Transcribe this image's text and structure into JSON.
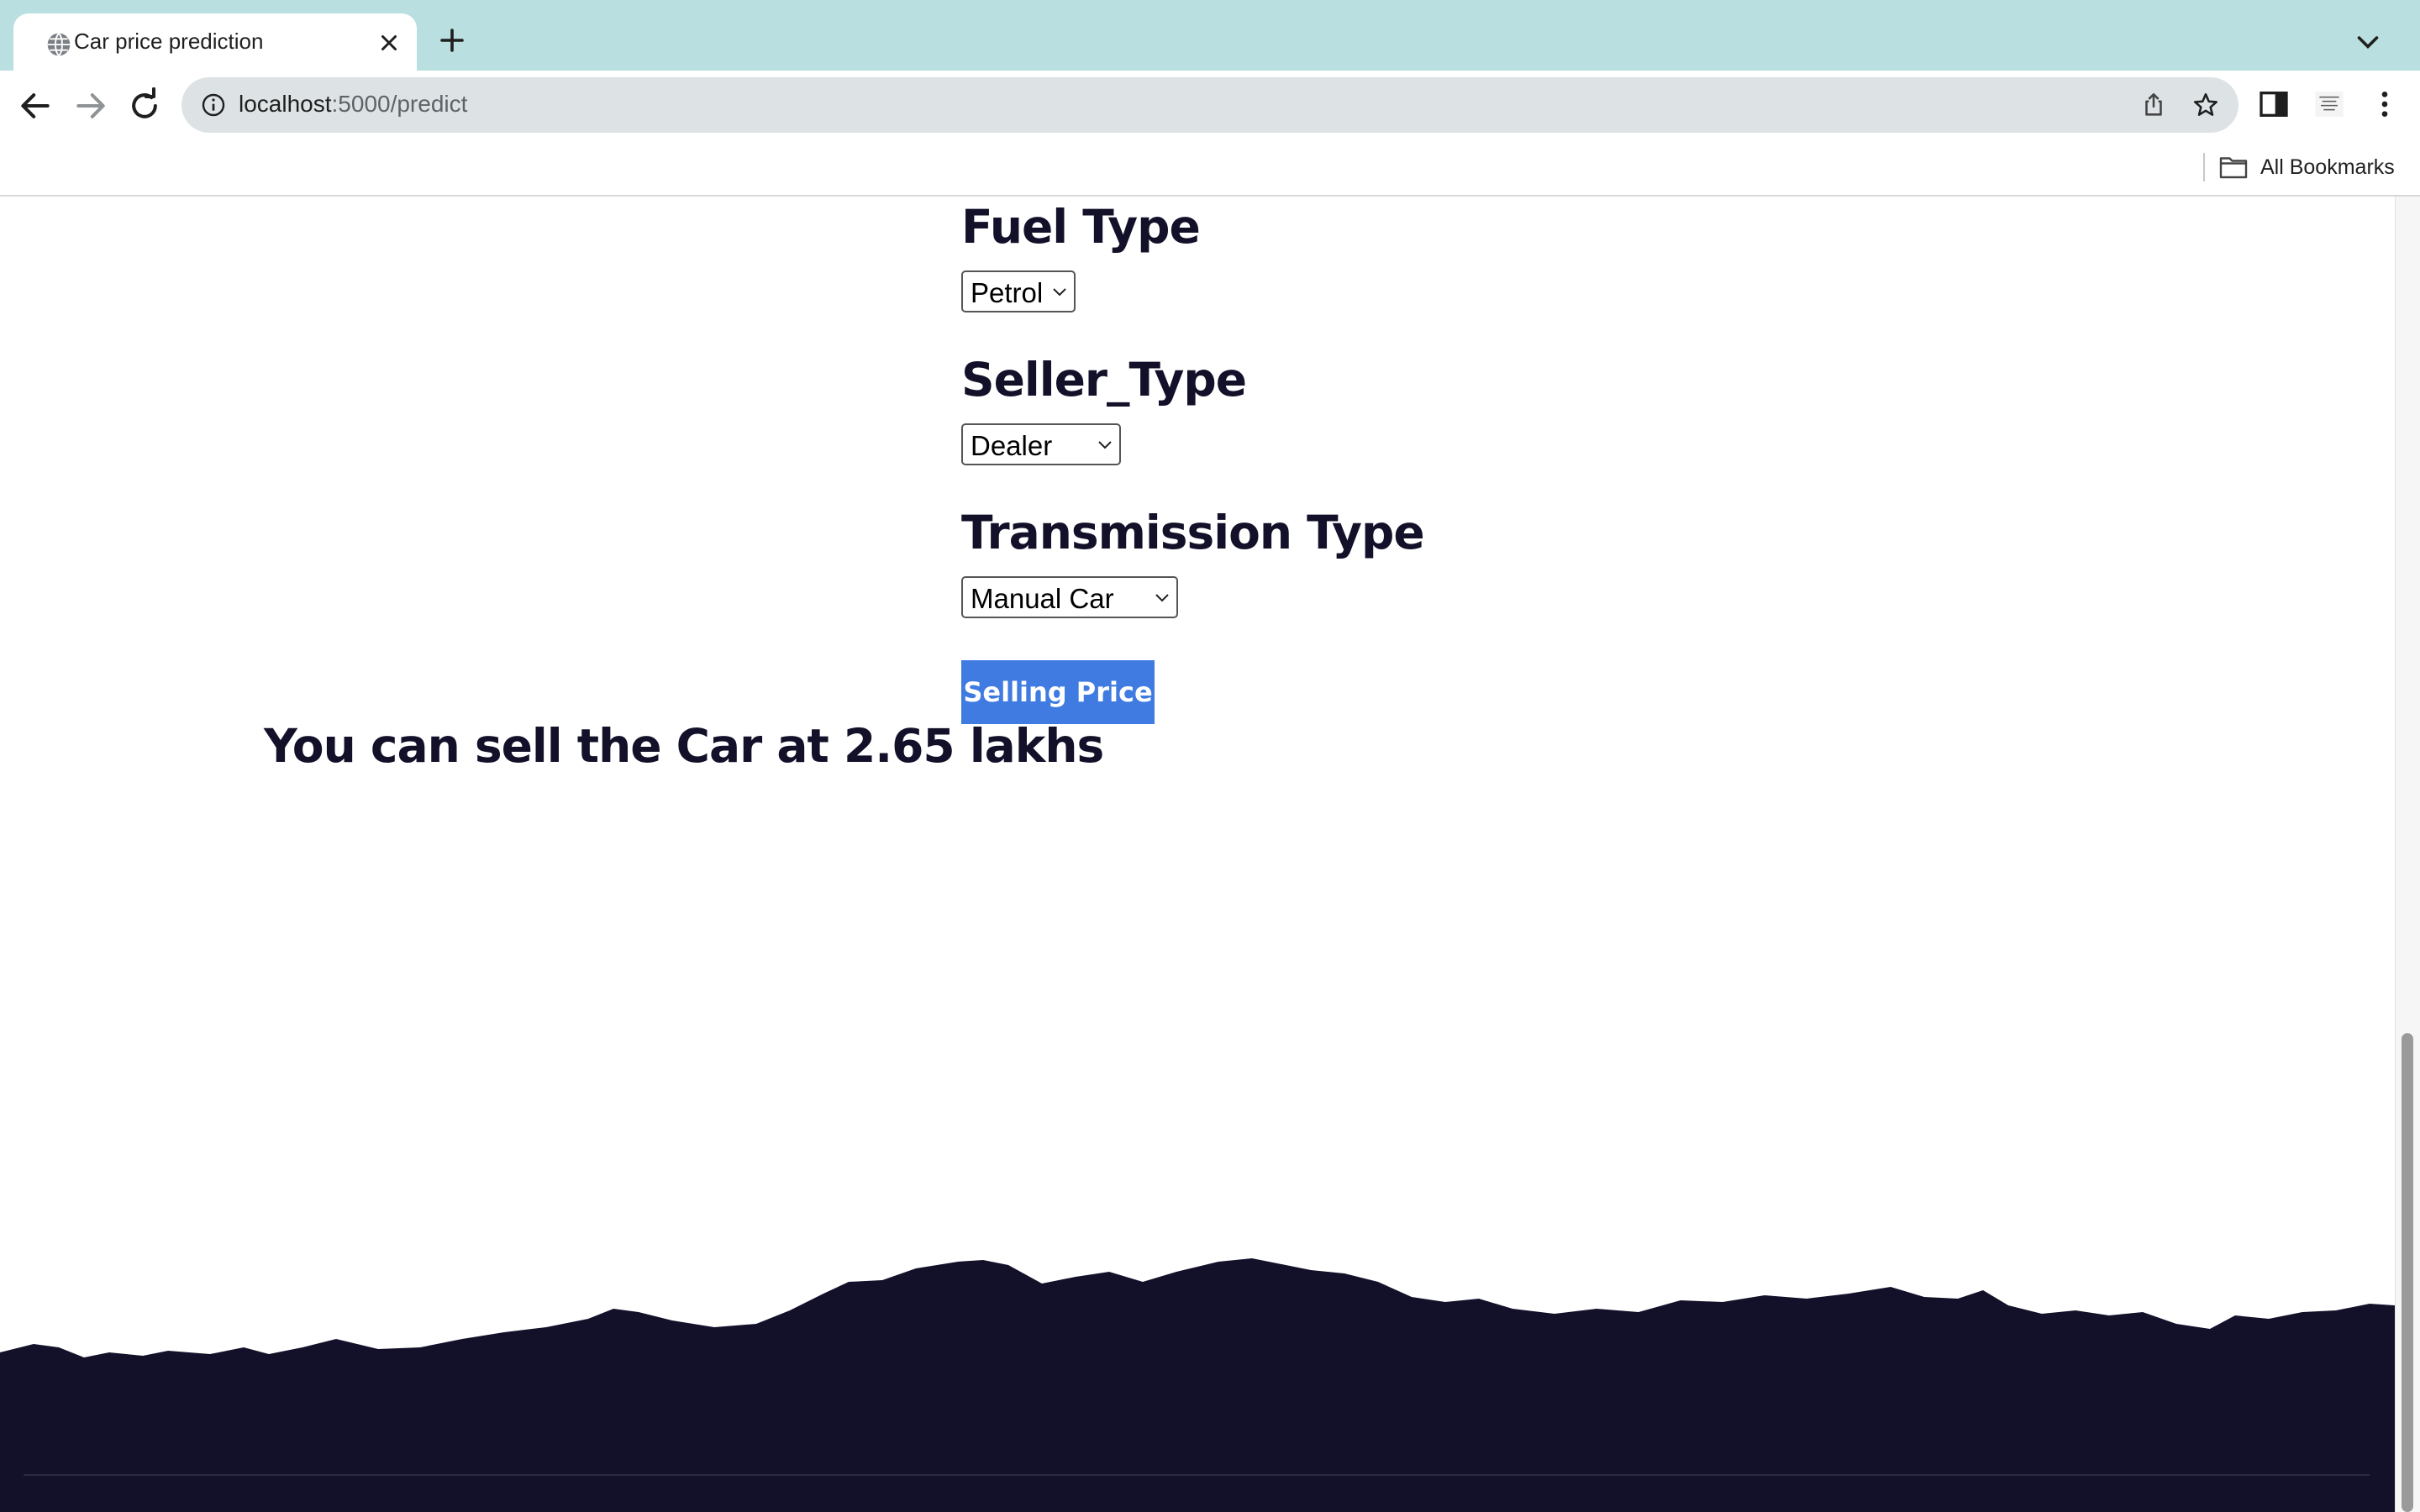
{
  "browser": {
    "tab": {
      "title": "Car price prediction",
      "favicon": "globe-icon"
    },
    "address": {
      "host": "localhost",
      "path": ":5000/predict"
    },
    "bookmarks": {
      "label": "All Bookmarks"
    }
  },
  "form": {
    "fuel": {
      "heading": "Fuel Type",
      "selected": "Petrol"
    },
    "seller": {
      "heading": "Seller_Type",
      "selected": "Dealer"
    },
    "transmission": {
      "heading": "Transmission Type",
      "selected": "Manual Car"
    },
    "submit_label": "Selling Price"
  },
  "result": {
    "text": "You can sell the Car at 2.65 lakhs"
  },
  "colors": {
    "tabbar": "#b9dfe0",
    "heading": "#13112a",
    "button": "#3f7be0",
    "footer": "#13112a"
  }
}
